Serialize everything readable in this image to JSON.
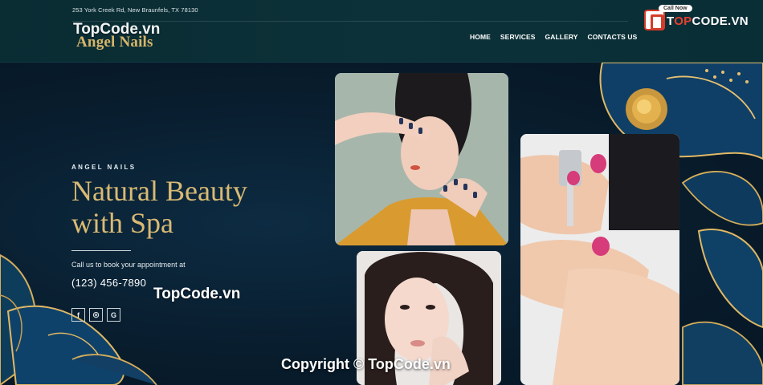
{
  "header": {
    "address": "253 York Creek Rd, New Braunfels, TX 78130",
    "logo": "Angel Nails",
    "nav": [
      "HOME",
      "SERVICES",
      "GALLERY",
      "CONTACTS US"
    ]
  },
  "watermarks": {
    "top": "TopCode.vn",
    "middle": "TopCode.vn",
    "bottom": "Copyright © TopCode.vn"
  },
  "brand_badge": {
    "call_now": "Call Now",
    "text_pre": "T",
    "text_hl": "OP",
    "text_post": "CODE.VN"
  },
  "hero": {
    "kicker": "ANGEL NAILS",
    "headline_line1": "Natural Beauty",
    "headline_line2": "with Spa",
    "call_text": "Call us to book your appointment at",
    "phone": "(123) 456-7890",
    "social": [
      {
        "icon": "facebook-icon",
        "glyph": "f"
      },
      {
        "icon": "instagram-icon",
        "glyph": "◎"
      },
      {
        "icon": "google-icon",
        "glyph": "G"
      }
    ]
  },
  "colors": {
    "accent_gold": "#d9ba73",
    "header_bg": "#0a2c33",
    "hero_bg": "#081c2c"
  }
}
